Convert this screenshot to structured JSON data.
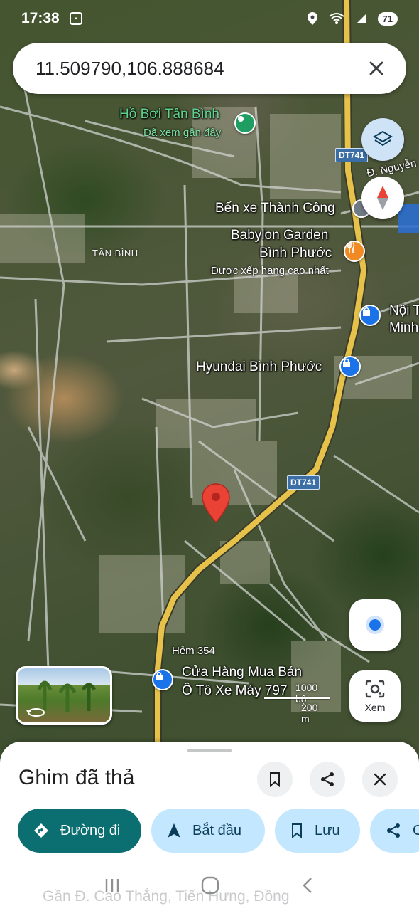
{
  "status_bar": {
    "time": "17:38",
    "battery": "71",
    "icons": [
      "screenshot-icon",
      "location-icon",
      "wifi-icon",
      "signal-icon",
      "battery-icon"
    ]
  },
  "search": {
    "query": "11.509790,106.888684"
  },
  "map": {
    "places": [
      {
        "name": "Hồ Bơi Tân Bình",
        "sub": "Đã xem gần đây"
      },
      {
        "name": "Bến xe Thành Công"
      },
      {
        "name": "Babylon Garden",
        "name2": "Bình Phước",
        "sub": "Được xếp hạng cao nhất"
      },
      {
        "name": "Nội T",
        "name2": "Minh"
      },
      {
        "name": "Hyundai Bình Phước"
      },
      {
        "name": "Cửa Hàng Mua Bán",
        "name2": "Ô Tô Xe Máy 797"
      }
    ],
    "area_label": "TÂN BÌNH",
    "road_labels": [
      "DT741",
      "DT741"
    ],
    "street_labels": [
      "Đ. Nguyễn",
      "Hẻm 354"
    ],
    "scale": {
      "top": "1000 bộ",
      "bottom": "200 m"
    }
  },
  "buttons": {
    "lens_label": "Xem"
  },
  "sheet": {
    "title": "Ghim đã thả",
    "chips": [
      {
        "label": "Đường đi",
        "icon": "directions-icon"
      },
      {
        "label": "Bắt đầu",
        "icon": "navigation-arrow-icon"
      },
      {
        "label": "Lưu",
        "icon": "bookmark-icon"
      },
      {
        "label": "C",
        "icon": "share-icon"
      }
    ],
    "address": "Gần Đ. Cao Thắng, Tiến Hưng, Đồng"
  },
  "colors": {
    "primary_chip": "#0b6e70",
    "secondary_chip": "#c2e7ff",
    "pin": "#ea4335",
    "road": "#e6c24a"
  }
}
